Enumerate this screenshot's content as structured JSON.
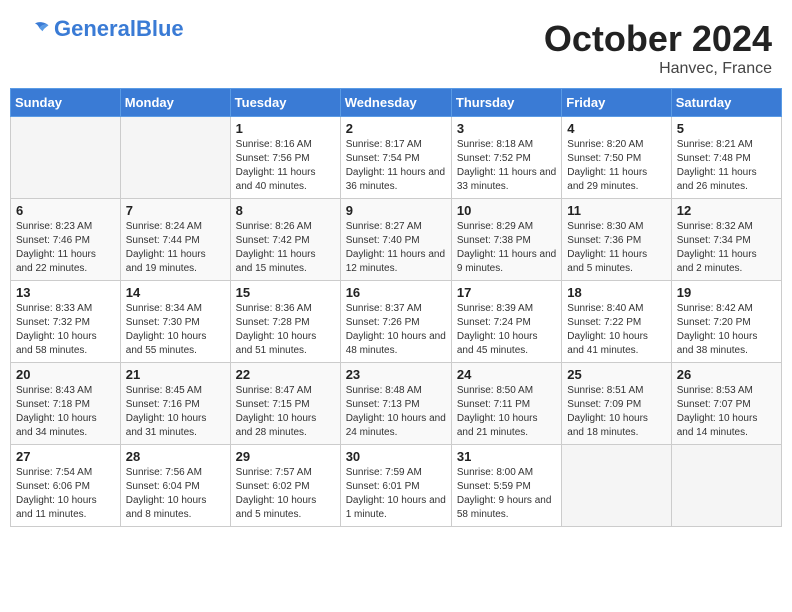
{
  "header": {
    "logo_general": "General",
    "logo_blue": "Blue",
    "title": "October 2024",
    "subtitle": "Hanvec, France"
  },
  "days_of_week": [
    "Sunday",
    "Monday",
    "Tuesday",
    "Wednesday",
    "Thursday",
    "Friday",
    "Saturday"
  ],
  "weeks": [
    [
      {
        "day": "",
        "info": ""
      },
      {
        "day": "",
        "info": ""
      },
      {
        "day": "1",
        "info": "Sunrise: 8:16 AM\nSunset: 7:56 PM\nDaylight: 11 hours and 40 minutes."
      },
      {
        "day": "2",
        "info": "Sunrise: 8:17 AM\nSunset: 7:54 PM\nDaylight: 11 hours and 36 minutes."
      },
      {
        "day": "3",
        "info": "Sunrise: 8:18 AM\nSunset: 7:52 PM\nDaylight: 11 hours and 33 minutes."
      },
      {
        "day": "4",
        "info": "Sunrise: 8:20 AM\nSunset: 7:50 PM\nDaylight: 11 hours and 29 minutes."
      },
      {
        "day": "5",
        "info": "Sunrise: 8:21 AM\nSunset: 7:48 PM\nDaylight: 11 hours and 26 minutes."
      }
    ],
    [
      {
        "day": "6",
        "info": "Sunrise: 8:23 AM\nSunset: 7:46 PM\nDaylight: 11 hours and 22 minutes."
      },
      {
        "day": "7",
        "info": "Sunrise: 8:24 AM\nSunset: 7:44 PM\nDaylight: 11 hours and 19 minutes."
      },
      {
        "day": "8",
        "info": "Sunrise: 8:26 AM\nSunset: 7:42 PM\nDaylight: 11 hours and 15 minutes."
      },
      {
        "day": "9",
        "info": "Sunrise: 8:27 AM\nSunset: 7:40 PM\nDaylight: 11 hours and 12 minutes."
      },
      {
        "day": "10",
        "info": "Sunrise: 8:29 AM\nSunset: 7:38 PM\nDaylight: 11 hours and 9 minutes."
      },
      {
        "day": "11",
        "info": "Sunrise: 8:30 AM\nSunset: 7:36 PM\nDaylight: 11 hours and 5 minutes."
      },
      {
        "day": "12",
        "info": "Sunrise: 8:32 AM\nSunset: 7:34 PM\nDaylight: 11 hours and 2 minutes."
      }
    ],
    [
      {
        "day": "13",
        "info": "Sunrise: 8:33 AM\nSunset: 7:32 PM\nDaylight: 10 hours and 58 minutes."
      },
      {
        "day": "14",
        "info": "Sunrise: 8:34 AM\nSunset: 7:30 PM\nDaylight: 10 hours and 55 minutes."
      },
      {
        "day": "15",
        "info": "Sunrise: 8:36 AM\nSunset: 7:28 PM\nDaylight: 10 hours and 51 minutes."
      },
      {
        "day": "16",
        "info": "Sunrise: 8:37 AM\nSunset: 7:26 PM\nDaylight: 10 hours and 48 minutes."
      },
      {
        "day": "17",
        "info": "Sunrise: 8:39 AM\nSunset: 7:24 PM\nDaylight: 10 hours and 45 minutes."
      },
      {
        "day": "18",
        "info": "Sunrise: 8:40 AM\nSunset: 7:22 PM\nDaylight: 10 hours and 41 minutes."
      },
      {
        "day": "19",
        "info": "Sunrise: 8:42 AM\nSunset: 7:20 PM\nDaylight: 10 hours and 38 minutes."
      }
    ],
    [
      {
        "day": "20",
        "info": "Sunrise: 8:43 AM\nSunset: 7:18 PM\nDaylight: 10 hours and 34 minutes."
      },
      {
        "day": "21",
        "info": "Sunrise: 8:45 AM\nSunset: 7:16 PM\nDaylight: 10 hours and 31 minutes."
      },
      {
        "day": "22",
        "info": "Sunrise: 8:47 AM\nSunset: 7:15 PM\nDaylight: 10 hours and 28 minutes."
      },
      {
        "day": "23",
        "info": "Sunrise: 8:48 AM\nSunset: 7:13 PM\nDaylight: 10 hours and 24 minutes."
      },
      {
        "day": "24",
        "info": "Sunrise: 8:50 AM\nSunset: 7:11 PM\nDaylight: 10 hours and 21 minutes."
      },
      {
        "day": "25",
        "info": "Sunrise: 8:51 AM\nSunset: 7:09 PM\nDaylight: 10 hours and 18 minutes."
      },
      {
        "day": "26",
        "info": "Sunrise: 8:53 AM\nSunset: 7:07 PM\nDaylight: 10 hours and 14 minutes."
      }
    ],
    [
      {
        "day": "27",
        "info": "Sunrise: 7:54 AM\nSunset: 6:06 PM\nDaylight: 10 hours and 11 minutes."
      },
      {
        "day": "28",
        "info": "Sunrise: 7:56 AM\nSunset: 6:04 PM\nDaylight: 10 hours and 8 minutes."
      },
      {
        "day": "29",
        "info": "Sunrise: 7:57 AM\nSunset: 6:02 PM\nDaylight: 10 hours and 5 minutes."
      },
      {
        "day": "30",
        "info": "Sunrise: 7:59 AM\nSunset: 6:01 PM\nDaylight: 10 hours and 1 minute."
      },
      {
        "day": "31",
        "info": "Sunrise: 8:00 AM\nSunset: 5:59 PM\nDaylight: 9 hours and 58 minutes."
      },
      {
        "day": "",
        "info": ""
      },
      {
        "day": "",
        "info": ""
      }
    ]
  ]
}
